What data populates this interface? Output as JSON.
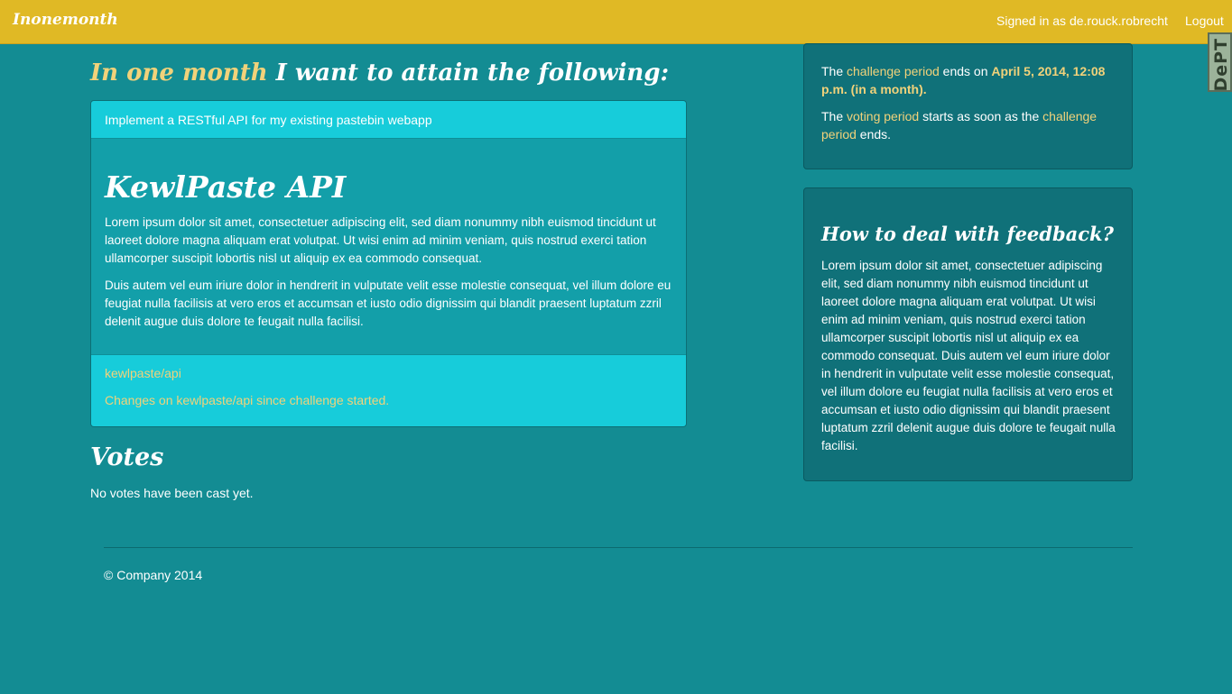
{
  "navbar": {
    "brand": "Inonemonth",
    "signed_in": "Signed in as de.rouck.robrecht",
    "logout": "Logout"
  },
  "badge": {
    "text": "DePT"
  },
  "main": {
    "heading_accent": "In one month",
    "heading_rest": " I want to attain the following:",
    "goal": {
      "summary": "Implement a RESTful API for my existing pastebin webapp",
      "title": "KewlPaste API",
      "paragraphs": [
        "Lorem ipsum dolor sit amet, consectetuer adipiscing elit, sed diam nonummy nibh euismod tincidunt ut laoreet dolore magna aliquam erat volutpat. Ut wisi enim ad minim veniam, quis nostrud exerci tation ullamcorper suscipit lobortis nisl ut aliquip ex ea commodo consequat.",
        "Duis autem vel eum iriure dolor in hendrerit in vulputate velit esse molestie consequat, vel illum dolore eu feugiat nulla facilisis at vero eros et accumsan et iusto odio dignissim qui blandit praesent luptatum zzril delenit augue duis dolore te feugait nulla facilisi."
      ],
      "repo_link": "kewlpaste/api",
      "changes_link": "Changes on kewlpaste/api since challenge started."
    },
    "votes": {
      "title": "Votes",
      "empty_text": "No votes have been cast yet."
    }
  },
  "sidebar": {
    "period": {
      "line1_prefix": "The ",
      "line1_link": "challenge period",
      "line1_middle": " ends on ",
      "line1_date": "April 5, 2014, 12:08 p.m. (in a month).",
      "line2_prefix": "The ",
      "line2_link1": "voting period",
      "line2_middle": " starts as soon as the ",
      "line2_link2": "challenge period",
      "line2_suffix": " ends."
    },
    "feedback": {
      "title": "How to deal with feedback?",
      "text": "Lorem ipsum dolor sit amet, consectetuer adipiscing elit, sed diam nonummy nibh euismod tincidunt ut laoreet dolore magna aliquam erat volutpat. Ut wisi enim ad minim veniam, quis nostrud exerci tation ullamcorper suscipit lobortis nisl ut aliquip ex ea commodo consequat. Duis autem vel eum iriure dolor in hendrerit in vulputate velit esse molestie consequat, vel illum dolore eu feugiat nulla facilisis at vero eros et accumsan et iusto odio dignissim qui blandit praesent luptatum zzril delenit augue duis dolore te feugait nulla facilisi."
    }
  },
  "footer": {
    "copyright": "© Company 2014"
  },
  "colors": {
    "background": "#138c93",
    "navbar": "#e0b925",
    "accent_text": "#f1d27a",
    "card_light": "#17ccda",
    "card_mid": "#139fa9",
    "side_card": "#107179"
  }
}
